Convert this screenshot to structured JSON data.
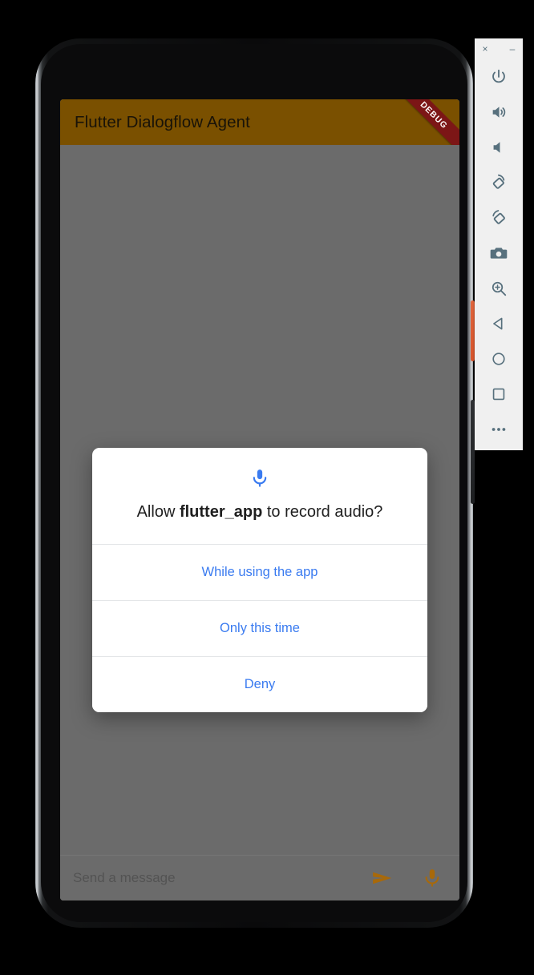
{
  "device": {
    "name": "android-emulator-phone",
    "hardware": {
      "front_camera": "front-camera",
      "proximity_sensor": "proximity-sensor",
      "earpiece": "earpiece-speaker",
      "power_button": "power-button",
      "volume_rocker": "volume-rocker"
    }
  },
  "app": {
    "appbar": {
      "title": "Flutter Dialogflow Agent",
      "debug_banner": "DEBUG",
      "background_color": "#7a5000",
      "title_color": "#191308",
      "debug_banner_color": "#7c1616"
    },
    "composer": {
      "placeholder": "Send a message",
      "value": "",
      "send_icon": "send-icon",
      "mic_icon": "microphone-icon",
      "icon_color": "#a8690a"
    }
  },
  "permission_dialog": {
    "icon": "microphone-icon",
    "icon_color": "#3a7bf0",
    "message_prefix": "Allow ",
    "message_app": "flutter_app",
    "message_suffix": " to record audio?",
    "accent_color": "#3a7bf0",
    "options": [
      {
        "label": "While using the app",
        "name": "allow-while-using-app-button"
      },
      {
        "label": "Only this time",
        "name": "allow-only-this-time-button"
      },
      {
        "label": "Deny",
        "name": "deny-button"
      }
    ]
  },
  "emulator_toolbar": {
    "background_color": "#f0f0f0",
    "icon_color": "#57707d",
    "window_controls": [
      {
        "label": "×",
        "name": "emulator-close-button"
      },
      {
        "label": "–",
        "name": "emulator-minimize-button"
      }
    ],
    "buttons": [
      {
        "name": "power-button",
        "icon": "power-icon"
      },
      {
        "name": "volume-up-button",
        "icon": "volume-up-icon"
      },
      {
        "name": "volume-down-button",
        "icon": "volume-down-icon"
      },
      {
        "name": "rotate-left-button",
        "icon": "rotate-left-icon"
      },
      {
        "name": "rotate-right-button",
        "icon": "rotate-right-icon"
      },
      {
        "name": "screenshot-button",
        "icon": "camera-icon"
      },
      {
        "name": "zoom-button",
        "icon": "magnifier-plus-icon"
      },
      {
        "name": "back-button",
        "icon": "triangle-left-icon"
      },
      {
        "name": "home-button",
        "icon": "circle-icon"
      },
      {
        "name": "overview-button",
        "icon": "square-icon"
      },
      {
        "name": "more-button",
        "icon": "ellipsis-icon"
      }
    ]
  }
}
